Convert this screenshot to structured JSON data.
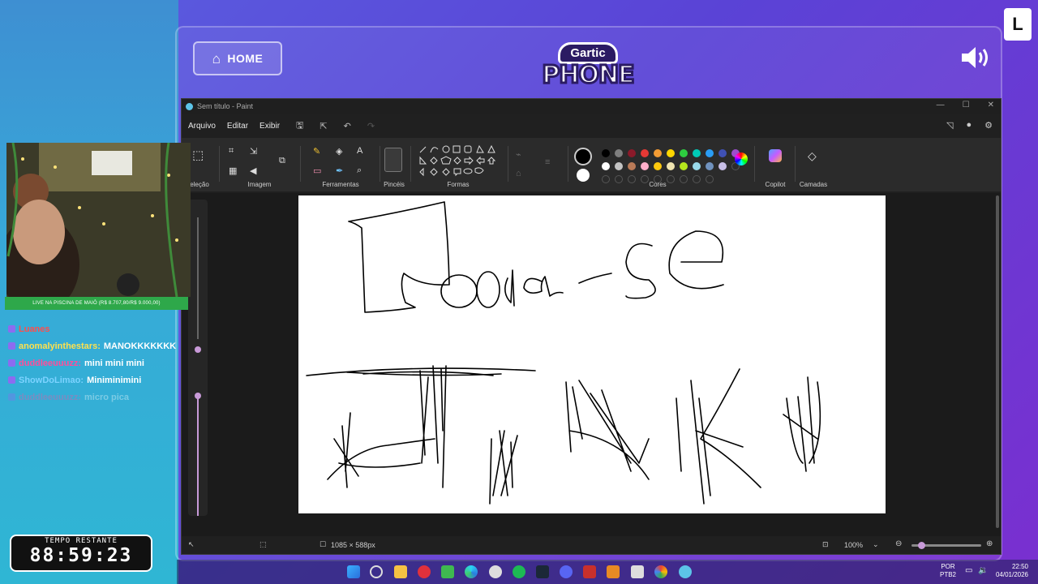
{
  "gartic": {
    "home_label": "HOME",
    "logo_top": "Gartic",
    "logo_bottom": "PHONE"
  },
  "paint": {
    "title": "Sem título - Paint",
    "menu": [
      "Arquivo",
      "Editar",
      "Exibir"
    ],
    "groups": {
      "selection": "eleção",
      "image": "Imagem",
      "tools": "Ferramentas",
      "brushes": "Pincéis",
      "shapes": "Formas",
      "colors": "Cores",
      "copilot": "Copilot",
      "layers": "Camadas"
    },
    "status": {
      "canvas_size": "1085 × 588px",
      "zoom": "100%"
    },
    "colors": {
      "row1": [
        "#000000",
        "#7f7f7f",
        "#8b1a2a",
        "#e53935",
        "#f39c34",
        "#ffd600",
        "#2ecc40",
        "#00c9b7",
        "#2a9df4",
        "#3f51b5",
        "#9c4dcc"
      ],
      "row2": [
        "#ffffff",
        "#c3c3c3",
        "#b97a57",
        "#ffaec9",
        "#ffc90e",
        "#efe4b0",
        "#b5e61d",
        "#99d9ea",
        "#7092be",
        "#c8bfe7"
      ]
    }
  },
  "stream": {
    "live_banner": "LIVE NA PISCINA DE MAIÔ (R$ 8.707,80/R$ 9.000,00)",
    "chat": [
      {
        "user": "Luanes",
        "message": "",
        "color": "#ff4d4d"
      },
      {
        "user": "anomalyinthestars:",
        "message": "MANOKKKKKKK",
        "color": "#ffe14d"
      },
      {
        "user": "duddleeuuuzz:",
        "message": "mini mini mini",
        "color": "#ff4d9a"
      },
      {
        "user": "ShowDoLimao:",
        "message": "Miniminimini",
        "color": "#7cd3ff"
      },
      {
        "user": "duddleeuuuzz:",
        "message": "micro pica",
        "color": "#ff4d9a"
      }
    ],
    "timer_label": "TEMPO RESTANTE",
    "timer_value": "88:59:23"
  },
  "taskbar": {
    "lang_top": "POR",
    "lang_bottom": "PTB2",
    "time": "22:50",
    "date": "04/01/2026"
  }
}
